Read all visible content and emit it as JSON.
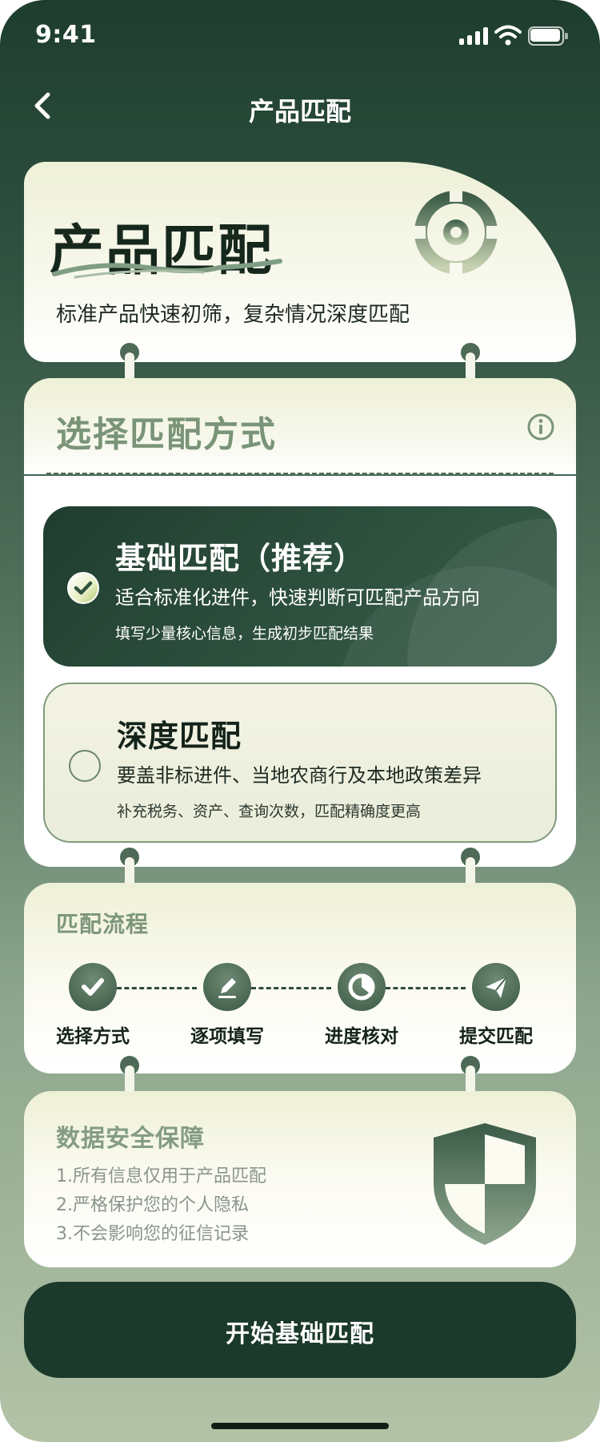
{
  "status_bar": {
    "time": "9:41"
  },
  "nav": {
    "title": "产品匹配",
    "back_icon": "chevron-left-icon"
  },
  "hero": {
    "title": "产品匹配",
    "subtitle": "标准产品快速初筛，复杂情况深度匹配",
    "icon": "target-icon"
  },
  "select_method": {
    "title": "选择匹配方式",
    "info_icon": "info-icon",
    "options": [
      {
        "title": "基础匹配（推荐）",
        "desc": "适合标准化进件，快速判断可匹配产品方向",
        "note": "填写少量核心信息，生成初步匹配结果",
        "selected": true
      },
      {
        "title": "深度匹配",
        "desc": "要盖非标进件、当地农商行及本地政策差异",
        "note": "补充税务、资产、查询次数，匹配精确度更高",
        "selected": false
      }
    ]
  },
  "flow": {
    "title": "匹配流程",
    "steps": [
      {
        "label": "选择方式",
        "icon": "check-icon"
      },
      {
        "label": "逐项填写",
        "icon": "pencil-icon"
      },
      {
        "label": "进度核对",
        "icon": "clock-icon"
      },
      {
        "label": "提交匹配",
        "icon": "send-icon"
      }
    ]
  },
  "security": {
    "title": "数据安全保障",
    "lines": [
      "1.所有信息仅用于产品匹配",
      "2.严格保护您的个人隐私",
      "3.不会影响您的征信记录"
    ],
    "icon": "shield-icon"
  },
  "cta": {
    "label": "开始基础匹配"
  },
  "colors": {
    "primary_dark": "#1c3a2b",
    "accent_green": "#4a6753",
    "muted_green_text": "#7a9478",
    "card_cream": "#eef0d6"
  }
}
